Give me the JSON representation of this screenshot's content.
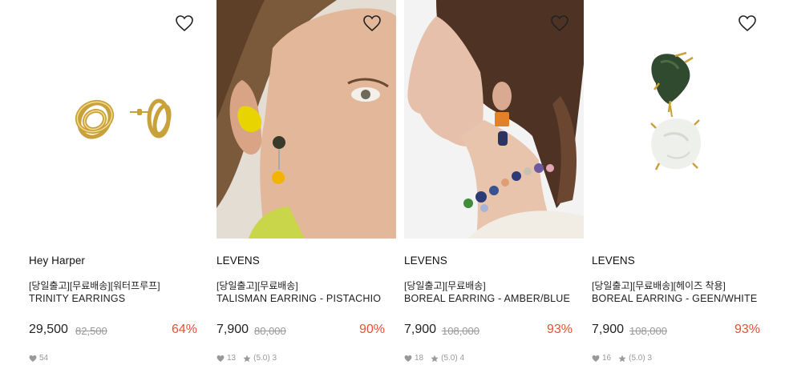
{
  "products": [
    {
      "brand": "Hey Harper",
      "promo": "[당일출고][무료배송][워터프루프]",
      "name": "TRINITY EARRINGS",
      "price": "29,500",
      "original_price": "82,500",
      "discount": "64%",
      "likes": "54",
      "rating": "",
      "reviews": "",
      "image": "gold knot stud earrings"
    },
    {
      "brand": "LEVENS",
      "promo": "[당일출고][무료배송]",
      "name": "TALISMAN EARRING - PISTACHIO",
      "price": "7,900",
      "original_price": "80,000",
      "discount": "90%",
      "likes": "13",
      "rating": "(5.0)",
      "reviews": "3",
      "image": "model wearing yellow earring"
    },
    {
      "brand": "LEVENS",
      "promo": "[당일출고][무료배송]",
      "name": "BOREAL EARRING - AMBER/BLUE",
      "price": "7,900",
      "original_price": "108,000",
      "discount": "93%",
      "likes": "18",
      "rating": "(5.0)",
      "reviews": "4",
      "image": "model wearing amber earring and necklace"
    },
    {
      "brand": "LEVENS",
      "promo": "[당일출고][무료배송][헤이즈 착용]",
      "name": "BOREAL EARRING - GEEN/WHITE",
      "price": "7,900",
      "original_price": "108,000",
      "discount": "93%",
      "likes": "16",
      "rating": "(5.0)",
      "reviews": "3",
      "image": "green and white stone drop earring"
    }
  ],
  "colors": {
    "discount": "#e8502f",
    "muted": "#999999",
    "text": "#222222"
  },
  "icons": {
    "wishlist": "heart-outline-icon",
    "likes": "heart-icon",
    "rating": "star-icon"
  }
}
